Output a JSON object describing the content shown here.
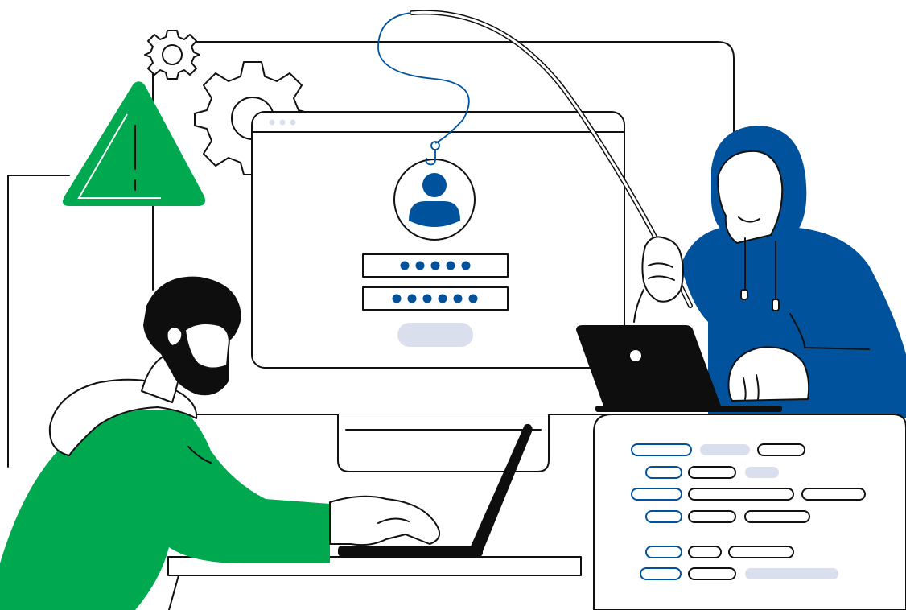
{
  "illustration": {
    "subject": "phishing",
    "colors": {
      "green": "#00A84F",
      "blue": "#00529C",
      "outline": "#111111",
      "light_gray": "#D9DFEC",
      "black": "#0E0E0E",
      "white": "#FFFFFF"
    },
    "login_form": {
      "username_mask_dots": 5,
      "password_mask_dots": 6
    },
    "icons": [
      "warning-icon",
      "gear-icon",
      "user-avatar-icon",
      "fishing-hook-icon",
      "laptop-icon"
    ]
  }
}
